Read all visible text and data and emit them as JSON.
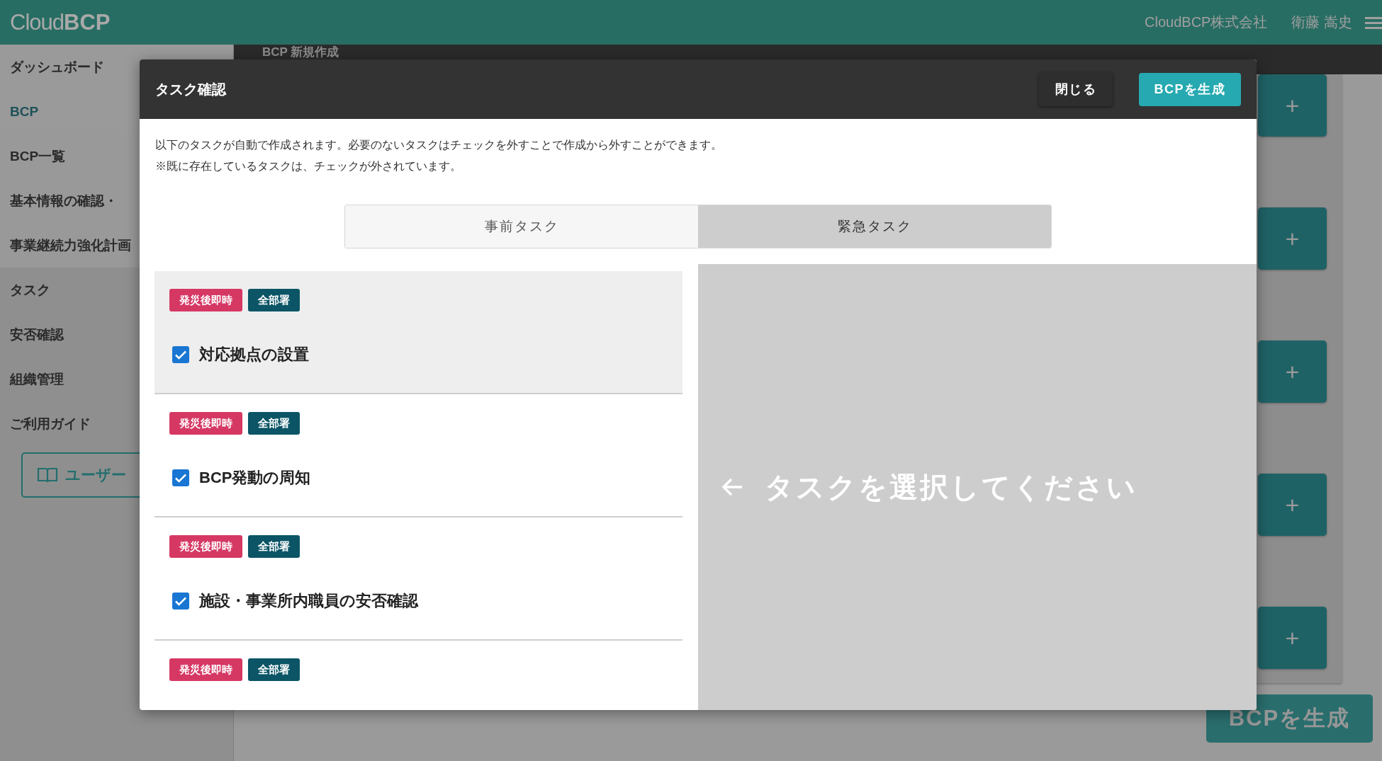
{
  "header": {
    "logo_light": "Cloud",
    "logo_bold": "BCP",
    "company": "CloudBCP株式会社",
    "user": "衛藤 嵩史"
  },
  "sidebar": {
    "items": [
      {
        "label": "ダッシュボード",
        "selected": false
      },
      {
        "label": "BCP",
        "selected": true,
        "expanded": true,
        "children": [
          {
            "label": "BCP一覧",
            "selected": false
          },
          {
            "label": "基本情報の確認・",
            "selected": false
          },
          {
            "label": "事業継続力強化計画",
            "selected": false
          }
        ]
      },
      {
        "label": "タスク",
        "selected": false
      },
      {
        "label": "安否確認",
        "selected": false
      },
      {
        "label": "組織管理",
        "selected": false
      },
      {
        "label": "ご利用ガイド",
        "selected": false
      }
    ],
    "guide_button": "ユーザー"
  },
  "page": {
    "title": "BCP 新規作成",
    "add_buttons": [
      "+",
      "+",
      "+",
      "+",
      "+"
    ],
    "generate_button": "BCPを生成"
  },
  "modal": {
    "title": "タスク確認",
    "buttons": [
      {
        "label": "閉じる",
        "kind": "secondary"
      },
      {
        "label": "BCPを生成",
        "kind": "primary"
      }
    ],
    "description": [
      "以下のタスクが自動で作成されます。必要のないタスクはチェックを外すことで作成から外すことができます。",
      "※既に存在しているタスクは、チェックが外されています。"
    ],
    "tabs": [
      {
        "label": "事前タスク",
        "selected": false
      },
      {
        "label": "緊急タスク",
        "selected": true
      }
    ],
    "tasks": [
      {
        "tags": [
          {
            "label": "発災後即時",
            "color": "#d63864"
          },
          {
            "label": "全部署",
            "color": "#0b5566"
          }
        ],
        "title": "対応拠点の設置",
        "checked": true,
        "selected": true
      },
      {
        "tags": [
          {
            "label": "発災後即時",
            "color": "#d63864"
          },
          {
            "label": "全部署",
            "color": "#0b5566"
          }
        ],
        "title": "BCP発動の周知",
        "checked": true,
        "selected": false
      },
      {
        "tags": [
          {
            "label": "発災後即時",
            "color": "#d63864"
          },
          {
            "label": "全部署",
            "color": "#0b5566"
          }
        ],
        "title": "施設・事業所内職員の安否確認",
        "checked": true,
        "selected": false
      },
      {
        "tags": [
          {
            "label": "発災後即時",
            "color": "#d63864"
          },
          {
            "label": "全部署",
            "color": "#0b5566"
          }
        ],
        "selected": false
      }
    ],
    "detail_placeholder": "タスクを選択してください"
  }
}
